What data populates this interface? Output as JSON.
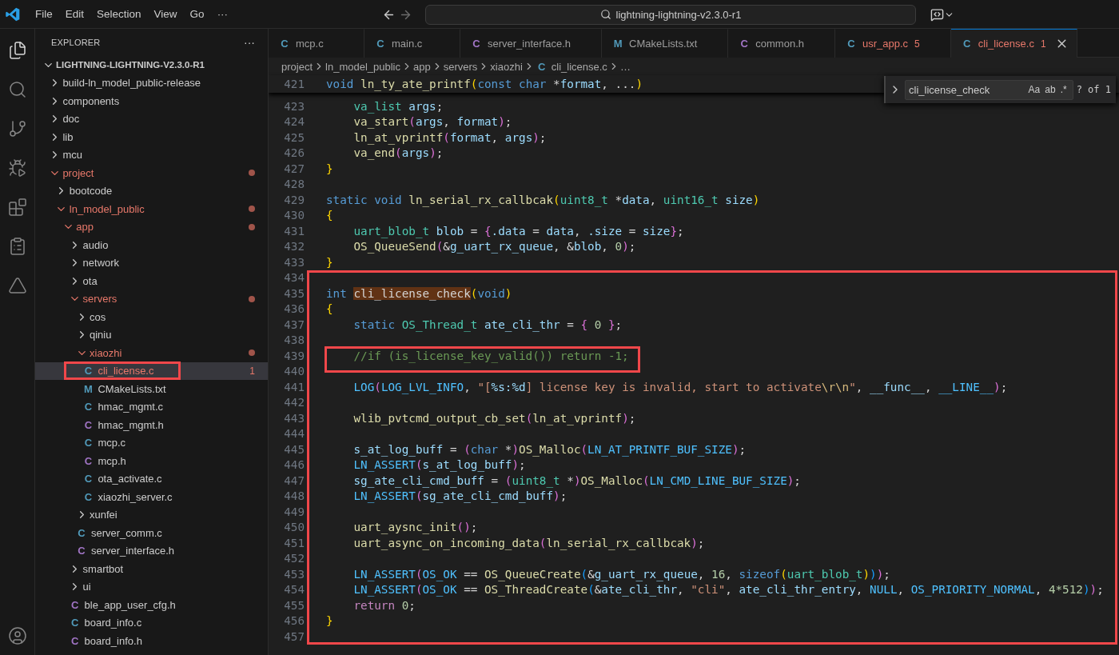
{
  "title_bar": {
    "menu": [
      "File",
      "Edit",
      "Selection",
      "View",
      "Go"
    ],
    "more": "···",
    "command_center": "lightning-lightning-v2.3.0-r1"
  },
  "activity_bar": {
    "items": [
      {
        "kind": "explorer",
        "selected": true
      },
      {
        "kind": "search",
        "selected": false
      },
      {
        "kind": "source_control",
        "selected": false
      },
      {
        "kind": "run_debug",
        "selected": false
      },
      {
        "kind": "extensions",
        "selected": false
      },
      {
        "kind": "tasks",
        "selected": false
      },
      {
        "kind": "deploy",
        "selected": false
      }
    ],
    "bottom": [
      {
        "kind": "account",
        "selected": false
      }
    ]
  },
  "explorer": {
    "title": "EXPLORER",
    "more": "···",
    "tree": {
      "kind": "root",
      "label": "LIGHTNING-LIGHTNING-V2.3.0-R1",
      "expanded": true,
      "modified": false,
      "selected": false,
      "boxed": false,
      "children": [
        {
          "kind": "folder",
          "label": "build-ln_model_public-release",
          "expanded": false,
          "modified": false,
          "selected": false,
          "boxed": false
        },
        {
          "kind": "folder",
          "label": "components",
          "expanded": false,
          "modified": false,
          "selected": false,
          "boxed": false
        },
        {
          "kind": "folder",
          "label": "doc",
          "expanded": false,
          "modified": false,
          "selected": false,
          "boxed": false
        },
        {
          "kind": "folder",
          "label": "lib",
          "expanded": false,
          "modified": false,
          "selected": false,
          "boxed": false
        },
        {
          "kind": "folder",
          "label": "mcu",
          "expanded": false,
          "modified": false,
          "selected": false,
          "boxed": false
        },
        {
          "kind": "folder",
          "label": "project",
          "expanded": true,
          "modified": true,
          "selected": false,
          "boxed": false,
          "children": [
            {
              "kind": "folder",
              "label": "bootcode",
              "expanded": false,
              "modified": false,
              "selected": false,
              "boxed": false
            },
            {
              "kind": "folder",
              "label": "ln_model_public",
              "expanded": true,
              "modified": true,
              "selected": false,
              "boxed": false,
              "children": [
                {
                  "kind": "folder",
                  "label": "app",
                  "expanded": true,
                  "modified": true,
                  "selected": false,
                  "boxed": false,
                  "children": [
                    {
                      "kind": "folder",
                      "label": "audio",
                      "expanded": false,
                      "modified": false,
                      "selected": false,
                      "boxed": false
                    },
                    {
                      "kind": "folder",
                      "label": "network",
                      "expanded": false,
                      "modified": false,
                      "selected": false,
                      "boxed": false
                    },
                    {
                      "kind": "folder",
                      "label": "ota",
                      "expanded": false,
                      "modified": false,
                      "selected": false,
                      "boxed": false
                    },
                    {
                      "kind": "folder",
                      "label": "servers",
                      "expanded": true,
                      "modified": true,
                      "selected": false,
                      "boxed": false,
                      "children": [
                        {
                          "kind": "folder",
                          "label": "cos",
                          "expanded": false,
                          "modified": false,
                          "selected": false,
                          "boxed": false
                        },
                        {
                          "kind": "folder",
                          "label": "qiniu",
                          "expanded": false,
                          "modified": false,
                          "selected": false,
                          "boxed": false
                        },
                        {
                          "kind": "folder",
                          "label": "xiaozhi",
                          "expanded": true,
                          "modified": true,
                          "selected": false,
                          "boxed": false,
                          "children": [
                            {
                              "kind": "source",
                              "icon": "C",
                              "label": "cli_license.c",
                              "badge": "1",
                              "modified": true,
                              "selected": true,
                              "boxed": true
                            },
                            {
                              "kind": "cmake",
                              "icon": "M",
                              "label": "CMakeLists.txt",
                              "modified": false,
                              "selected": false,
                              "boxed": false
                            },
                            {
                              "kind": "source",
                              "icon": "C",
                              "label": "hmac_mgmt.c",
                              "modified": false,
                              "selected": false,
                              "boxed": false
                            },
                            {
                              "kind": "header",
                              "icon": "C",
                              "label": "hmac_mgmt.h",
                              "modified": false,
                              "selected": false,
                              "boxed": false
                            },
                            {
                              "kind": "source",
                              "icon": "C",
                              "label": "mcp.c",
                              "modified": false,
                              "selected": false,
                              "boxed": false
                            },
                            {
                              "kind": "header",
                              "icon": "C",
                              "label": "mcp.h",
                              "modified": false,
                              "selected": false,
                              "boxed": false
                            },
                            {
                              "kind": "source",
                              "icon": "C",
                              "label": "ota_activate.c",
                              "modified": false,
                              "selected": false,
                              "boxed": false
                            },
                            {
                              "kind": "source",
                              "icon": "C",
                              "label": "xiaozhi_server.c",
                              "modified": false,
                              "selected": false,
                              "boxed": false
                            }
                          ]
                        },
                        {
                          "kind": "folder",
                          "label": "xunfei",
                          "expanded": false,
                          "modified": false,
                          "selected": false,
                          "boxed": false
                        },
                        {
                          "kind": "source",
                          "icon": "C",
                          "label": "server_comm.c",
                          "modified": false,
                          "selected": false,
                          "boxed": false
                        },
                        {
                          "kind": "header",
                          "icon": "C",
                          "label": "server_interface.h",
                          "modified": false,
                          "selected": false,
                          "boxed": false
                        }
                      ]
                    },
                    {
                      "kind": "folder",
                      "label": "smartbot",
                      "expanded": false,
                      "modified": false,
                      "selected": false,
                      "boxed": false
                    },
                    {
                      "kind": "folder",
                      "label": "ui",
                      "expanded": false,
                      "modified": false,
                      "selected": false,
                      "boxed": false
                    },
                    {
                      "kind": "header",
                      "icon": "C",
                      "label": "ble_app_user_cfg.h",
                      "modified": false,
                      "selected": false,
                      "boxed": false
                    },
                    {
                      "kind": "source",
                      "icon": "C",
                      "label": "board_info.c",
                      "modified": false,
                      "selected": false,
                      "boxed": false
                    },
                    {
                      "kind": "header",
                      "icon": "C",
                      "label": "board_info.h",
                      "modified": false,
                      "selected": false,
                      "boxed": false
                    }
                  ]
                }
              ]
            }
          ]
        }
      ]
    }
  },
  "tabs": [
    {
      "kind": "source",
      "icon": "C",
      "label": "mcp.c",
      "selected": false,
      "modified": false
    },
    {
      "kind": "source",
      "icon": "C",
      "label": "main.c",
      "selected": false,
      "modified": false
    },
    {
      "kind": "header",
      "icon": "C",
      "label": "server_interface.h",
      "selected": false,
      "modified": false
    },
    {
      "kind": "cmake",
      "icon": "M",
      "label": "CMakeLists.txt",
      "selected": false,
      "modified": false
    },
    {
      "kind": "header",
      "icon": "C",
      "label": "common.h",
      "selected": false,
      "modified": false
    },
    {
      "kind": "source",
      "icon": "C",
      "label": "usr_app.c",
      "badge": "5",
      "selected": false,
      "modified": true
    },
    {
      "kind": "source",
      "icon": "C",
      "label": "cli_license.c",
      "badge": "1",
      "selected": true,
      "modified": true
    }
  ],
  "breadcrumb": [
    {
      "kind": "folder",
      "label": "project"
    },
    {
      "kind": "folder",
      "label": "ln_model_public"
    },
    {
      "kind": "folder",
      "label": "app"
    },
    {
      "kind": "folder",
      "label": "servers"
    },
    {
      "kind": "folder",
      "label": "xiaozhi"
    },
    {
      "kind": "source",
      "icon": "C",
      "label": "cli_license.c"
    },
    {
      "kind": "symbol",
      "label": "…"
    }
  ],
  "find": {
    "value": "cli_license_check",
    "options": [
      "Aa",
      "ab",
      ".*"
    ],
    "result": "? of 1"
  },
  "code": {
    "sticky_line": {
      "n": "421",
      "tokens": [
        {
          "kind": "kw",
          "text": "void "
        },
        {
          "kind": "fn",
          "text": "ln_ty_ate_printf"
        },
        {
          "kind": "b1",
          "text": "("
        },
        {
          "kind": "kw",
          "text": "const char "
        },
        {
          "kind": "p",
          "text": "*"
        },
        {
          "kind": "var",
          "text": "format"
        },
        {
          "kind": "p",
          "text": ", ..."
        },
        {
          "kind": "b1",
          "text": ")"
        }
      ]
    },
    "lines": [
      {
        "n": "423",
        "boxed": false,
        "marked": false,
        "tokens": [
          {
            "kind": "ty",
            "text": "    va_list "
          },
          {
            "kind": "var",
            "text": "args"
          },
          {
            "kind": "p",
            "text": ";"
          }
        ]
      },
      {
        "n": "424",
        "boxed": false,
        "marked": false,
        "tokens": [
          {
            "kind": "fn",
            "text": "    va_start"
          },
          {
            "kind": "b2",
            "text": "("
          },
          {
            "kind": "var",
            "text": "args"
          },
          {
            "kind": "p",
            "text": ", "
          },
          {
            "kind": "var",
            "text": "format"
          },
          {
            "kind": "b2",
            "text": ")"
          },
          {
            "kind": "p",
            "text": ";"
          }
        ]
      },
      {
        "n": "425",
        "boxed": false,
        "marked": false,
        "tokens": [
          {
            "kind": "fn",
            "text": "    ln_at_vprintf"
          },
          {
            "kind": "b2",
            "text": "("
          },
          {
            "kind": "var",
            "text": "format"
          },
          {
            "kind": "p",
            "text": ", "
          },
          {
            "kind": "var",
            "text": "args"
          },
          {
            "kind": "b2",
            "text": ")"
          },
          {
            "kind": "p",
            "text": ";"
          }
        ]
      },
      {
        "n": "426",
        "boxed": false,
        "marked": false,
        "tokens": [
          {
            "kind": "fn",
            "text": "    va_end"
          },
          {
            "kind": "b2",
            "text": "("
          },
          {
            "kind": "var",
            "text": "args"
          },
          {
            "kind": "b2",
            "text": ")"
          },
          {
            "kind": "p",
            "text": ";"
          }
        ]
      },
      {
        "n": "427",
        "boxed": false,
        "marked": false,
        "tokens": [
          {
            "kind": "b1",
            "text": "}"
          }
        ]
      },
      {
        "n": "428",
        "boxed": false,
        "marked": false
      },
      {
        "n": "429",
        "boxed": false,
        "marked": false,
        "tokens": [
          {
            "kind": "kw",
            "text": "static void "
          },
          {
            "kind": "fn",
            "text": "ln_serial_rx_callbcak"
          },
          {
            "kind": "b1",
            "text": "("
          },
          {
            "kind": "ty",
            "text": "uint8_t "
          },
          {
            "kind": "p",
            "text": "*"
          },
          {
            "kind": "var",
            "text": "data"
          },
          {
            "kind": "p",
            "text": ", "
          },
          {
            "kind": "ty",
            "text": "uint16_t "
          },
          {
            "kind": "var",
            "text": "size"
          },
          {
            "kind": "b1",
            "text": ")"
          }
        ]
      },
      {
        "n": "430",
        "boxed": false,
        "marked": false,
        "tokens": [
          {
            "kind": "b1",
            "text": "{"
          }
        ]
      },
      {
        "n": "431",
        "boxed": false,
        "marked": false,
        "tokens": [
          {
            "kind": "ty",
            "text": "    uart_blob_t "
          },
          {
            "kind": "var",
            "text": "blob"
          },
          {
            "kind": "p",
            "text": " = "
          },
          {
            "kind": "b2",
            "text": "{"
          },
          {
            "kind": "var",
            "text": ".data"
          },
          {
            "kind": "p",
            "text": " = "
          },
          {
            "kind": "var",
            "text": "data"
          },
          {
            "kind": "p",
            "text": ", "
          },
          {
            "kind": "var",
            "text": ".size"
          },
          {
            "kind": "p",
            "text": " = "
          },
          {
            "kind": "var",
            "text": "size"
          },
          {
            "kind": "b2",
            "text": "}"
          },
          {
            "kind": "p",
            "text": ";"
          }
        ]
      },
      {
        "n": "432",
        "boxed": false,
        "marked": false,
        "tokens": [
          {
            "kind": "fn",
            "text": "    OS_QueueSend"
          },
          {
            "kind": "b2",
            "text": "("
          },
          {
            "kind": "p",
            "text": "&"
          },
          {
            "kind": "var",
            "text": "g_uart_rx_queue"
          },
          {
            "kind": "p",
            "text": ", &"
          },
          {
            "kind": "var",
            "text": "blob"
          },
          {
            "kind": "p",
            "text": ", "
          },
          {
            "kind": "num",
            "text": "0"
          },
          {
            "kind": "b2",
            "text": ")"
          },
          {
            "kind": "p",
            "text": ";"
          }
        ]
      },
      {
        "n": "433",
        "boxed": false,
        "marked": false,
        "tokens": [
          {
            "kind": "b1",
            "text": "}"
          }
        ]
      },
      {
        "n": "434",
        "boxed": true,
        "marked": false
      },
      {
        "n": "435",
        "boxed": true,
        "marked": false,
        "tokens": [
          {
            "kind": "kw",
            "text": "int "
          },
          {
            "kind": "match",
            "text": "cli_license_check"
          },
          {
            "kind": "b1",
            "text": "("
          },
          {
            "kind": "kw",
            "text": "void"
          },
          {
            "kind": "b1",
            "text": ")"
          }
        ]
      },
      {
        "n": "436",
        "boxed": true,
        "marked": false,
        "tokens": [
          {
            "kind": "b1",
            "text": "{"
          }
        ]
      },
      {
        "n": "437",
        "boxed": true,
        "marked": false,
        "tokens": [
          {
            "kind": "kw",
            "text": "    static "
          },
          {
            "kind": "ty",
            "text": "OS_Thread_t "
          },
          {
            "kind": "var",
            "text": "ate_cli_thr"
          },
          {
            "kind": "p",
            "text": " = "
          },
          {
            "kind": "b2",
            "text": "{"
          },
          {
            "kind": "num",
            "text": " 0 "
          },
          {
            "kind": "b2",
            "text": "}"
          },
          {
            "kind": "p",
            "text": ";"
          }
        ]
      },
      {
        "n": "438",
        "boxed": true,
        "marked": false
      },
      {
        "n": "439",
        "boxed": true,
        "marked": true,
        "tokens": [
          {
            "kind": "cm",
            "text": "    //if (is_license_key_valid()) return -1;"
          }
        ]
      },
      {
        "n": "440",
        "boxed": true,
        "marked": false
      },
      {
        "n": "441",
        "boxed": true,
        "marked": false,
        "tokens": [
          {
            "kind": "mac",
            "text": "    LOG"
          },
          {
            "kind": "b2",
            "text": "("
          },
          {
            "kind": "mac",
            "text": "LOG_LVL_INFO"
          },
          {
            "kind": "p",
            "text": ", "
          },
          {
            "kind": "str",
            "text": "\"["
          },
          {
            "kind": "var",
            "text": "%s:%d"
          },
          {
            "kind": "str",
            "text": "] license key is invalid, start to activate"
          },
          {
            "kind": "esc",
            "text": "\\r\\n"
          },
          {
            "kind": "str",
            "text": "\""
          },
          {
            "kind": "p",
            "text": ", "
          },
          {
            "kind": "var",
            "text": "__func__"
          },
          {
            "kind": "p",
            "text": ", "
          },
          {
            "kind": "mac",
            "text": "__LINE__"
          },
          {
            "kind": "b2",
            "text": ")"
          },
          {
            "kind": "p",
            "text": ";"
          }
        ]
      },
      {
        "n": "442",
        "boxed": true,
        "marked": false
      },
      {
        "n": "443",
        "boxed": true,
        "marked": false,
        "tokens": [
          {
            "kind": "fn",
            "text": "    wlib_pvtcmd_output_cb_set"
          },
          {
            "kind": "b2",
            "text": "("
          },
          {
            "kind": "fn",
            "text": "ln_at_vprintf"
          },
          {
            "kind": "b2",
            "text": ")"
          },
          {
            "kind": "p",
            "text": ";"
          }
        ]
      },
      {
        "n": "444",
        "boxed": true,
        "marked": false
      },
      {
        "n": "445",
        "boxed": true,
        "marked": false,
        "tokens": [
          {
            "kind": "var",
            "text": "    s_at_log_buff"
          },
          {
            "kind": "p",
            "text": " = "
          },
          {
            "kind": "b2",
            "text": "("
          },
          {
            "kind": "kw",
            "text": "char "
          },
          {
            "kind": "p",
            "text": "*"
          },
          {
            "kind": "b2",
            "text": ")"
          },
          {
            "kind": "fn",
            "text": "OS_Malloc"
          },
          {
            "kind": "b2",
            "text": "("
          },
          {
            "kind": "mac",
            "text": "LN_AT_PRINTF_BUF_SIZE"
          },
          {
            "kind": "b2",
            "text": ")"
          },
          {
            "kind": "p",
            "text": ";"
          }
        ]
      },
      {
        "n": "446",
        "boxed": true,
        "marked": false,
        "tokens": [
          {
            "kind": "mac",
            "text": "    LN_ASSERT"
          },
          {
            "kind": "b2",
            "text": "("
          },
          {
            "kind": "var",
            "text": "s_at_log_buff"
          },
          {
            "kind": "b2",
            "text": ")"
          },
          {
            "kind": "p",
            "text": ";"
          }
        ]
      },
      {
        "n": "447",
        "boxed": true,
        "marked": false,
        "tokens": [
          {
            "kind": "var",
            "text": "    sg_ate_cli_cmd_buff"
          },
          {
            "kind": "p",
            "text": " = "
          },
          {
            "kind": "b2",
            "text": "("
          },
          {
            "kind": "ty",
            "text": "uint8_t "
          },
          {
            "kind": "p",
            "text": "*"
          },
          {
            "kind": "b2",
            "text": ")"
          },
          {
            "kind": "fn",
            "text": "OS_Malloc"
          },
          {
            "kind": "b2",
            "text": "("
          },
          {
            "kind": "mac",
            "text": "LN_CMD_LINE_BUF_SIZE"
          },
          {
            "kind": "b2",
            "text": ")"
          },
          {
            "kind": "p",
            "text": ";"
          }
        ]
      },
      {
        "n": "448",
        "boxed": true,
        "marked": false,
        "tokens": [
          {
            "kind": "mac",
            "text": "    LN_ASSERT"
          },
          {
            "kind": "b2",
            "text": "("
          },
          {
            "kind": "var",
            "text": "sg_ate_cli_cmd_buff"
          },
          {
            "kind": "b2",
            "text": ")"
          },
          {
            "kind": "p",
            "text": ";"
          }
        ]
      },
      {
        "n": "449",
        "boxed": true,
        "marked": false
      },
      {
        "n": "450",
        "boxed": true,
        "marked": false,
        "tokens": [
          {
            "kind": "fn",
            "text": "    uart_aysnc_init"
          },
          {
            "kind": "b2",
            "text": "()"
          },
          {
            "kind": "p",
            "text": ";"
          }
        ]
      },
      {
        "n": "451",
        "boxed": true,
        "marked": false,
        "tokens": [
          {
            "kind": "fn",
            "text": "    uart_async_on_incoming_data"
          },
          {
            "kind": "b2",
            "text": "("
          },
          {
            "kind": "fn",
            "text": "ln_serial_rx_callbcak"
          },
          {
            "kind": "b2",
            "text": ")"
          },
          {
            "kind": "p",
            "text": ";"
          }
        ]
      },
      {
        "n": "452",
        "boxed": true,
        "marked": false
      },
      {
        "n": "453",
        "boxed": true,
        "marked": false,
        "tokens": [
          {
            "kind": "mac",
            "text": "    LN_ASSERT"
          },
          {
            "kind": "b2",
            "text": "("
          },
          {
            "kind": "mac",
            "text": "OS_OK"
          },
          {
            "kind": "p",
            "text": " == "
          },
          {
            "kind": "fn",
            "text": "OS_QueueCreate"
          },
          {
            "kind": "b3",
            "text": "("
          },
          {
            "kind": "p",
            "text": "&"
          },
          {
            "kind": "var",
            "text": "g_uart_rx_queue"
          },
          {
            "kind": "p",
            "text": ", "
          },
          {
            "kind": "num",
            "text": "16"
          },
          {
            "kind": "p",
            "text": ", "
          },
          {
            "kind": "kw",
            "text": "sizeof"
          },
          {
            "kind": "b1",
            "text": "("
          },
          {
            "kind": "ty",
            "text": "uart_blob_t"
          },
          {
            "kind": "b1",
            "text": ")"
          },
          {
            "kind": "b3",
            "text": ")"
          },
          {
            "kind": "b2",
            "text": ")"
          },
          {
            "kind": "p",
            "text": ";"
          }
        ]
      },
      {
        "n": "454",
        "boxed": true,
        "marked": false,
        "tokens": [
          {
            "kind": "mac",
            "text": "    LN_ASSERT"
          },
          {
            "kind": "b2",
            "text": "("
          },
          {
            "kind": "mac",
            "text": "OS_OK"
          },
          {
            "kind": "p",
            "text": " == "
          },
          {
            "kind": "fn",
            "text": "OS_ThreadCreate"
          },
          {
            "kind": "b3",
            "text": "("
          },
          {
            "kind": "p",
            "text": "&"
          },
          {
            "kind": "var",
            "text": "ate_cli_thr"
          },
          {
            "kind": "p",
            "text": ", "
          },
          {
            "kind": "str",
            "text": "\"cli\""
          },
          {
            "kind": "p",
            "text": ", "
          },
          {
            "kind": "var",
            "text": "ate_cli_thr_entry"
          },
          {
            "kind": "p",
            "text": ", "
          },
          {
            "kind": "mac",
            "text": "NULL"
          },
          {
            "kind": "p",
            "text": ", "
          },
          {
            "kind": "mac",
            "text": "OS_PRIORITY_NORMAL"
          },
          {
            "kind": "p",
            "text": ", "
          },
          {
            "kind": "num",
            "text": "4*512"
          },
          {
            "kind": "b3",
            "text": ")"
          },
          {
            "kind": "b2",
            "text": ")"
          },
          {
            "kind": "p",
            "text": ";"
          }
        ]
      },
      {
        "n": "455",
        "boxed": true,
        "marked": false,
        "tokens": [
          {
            "kind": "ctl",
            "text": "    return "
          },
          {
            "kind": "num",
            "text": "0"
          },
          {
            "kind": "p",
            "text": ";"
          }
        ]
      },
      {
        "n": "456",
        "boxed": true,
        "marked": false,
        "tokens": [
          {
            "kind": "b1",
            "text": "}"
          }
        ]
      },
      {
        "n": "457",
        "boxed": true,
        "marked": false
      }
    ]
  }
}
